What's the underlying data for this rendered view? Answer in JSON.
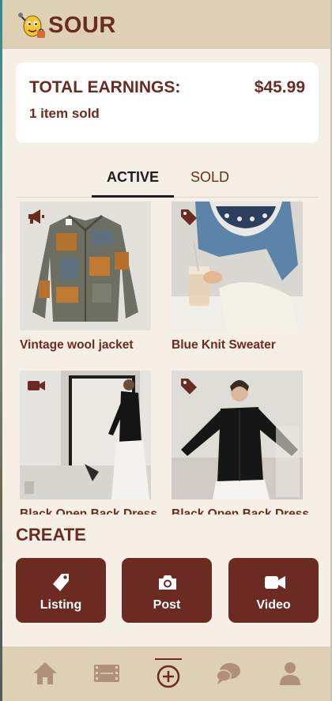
{
  "app": {
    "brand": "SOUR"
  },
  "earnings": {
    "label": "TOTAL EARNINGS:",
    "value": "$45.99",
    "sub": "1 item sold"
  },
  "tabs": [
    {
      "label": "ACTIVE",
      "active": true
    },
    {
      "label": "SOLD",
      "active": false
    }
  ],
  "listings": [
    {
      "title": "Vintage wool jacket",
      "badge": "megaphone-icon"
    },
    {
      "title": "Blue Knit Sweater",
      "badge": "tag-icon"
    },
    {
      "title": "Black Open Back Dress",
      "badge": "video-icon"
    },
    {
      "title": "Black Open Back Dress",
      "badge": "tag-icon"
    }
  ],
  "create": {
    "title": "CREATE",
    "buttons": [
      {
        "label": "Listing",
        "icon": "tag-icon"
      },
      {
        "label": "Post",
        "icon": "camera-icon"
      },
      {
        "label": "Video",
        "icon": "video-camera-icon"
      }
    ]
  },
  "nav": [
    {
      "icon": "home-icon"
    },
    {
      "icon": "film-icon"
    },
    {
      "icon": "add-icon",
      "active": true
    },
    {
      "icon": "chat-icon"
    },
    {
      "icon": "profile-icon"
    }
  ],
  "colors": {
    "accent": "#6b2a22",
    "header": "#ddd0b3",
    "background": "#f6efe6",
    "nav_icon": "#b0907a"
  }
}
